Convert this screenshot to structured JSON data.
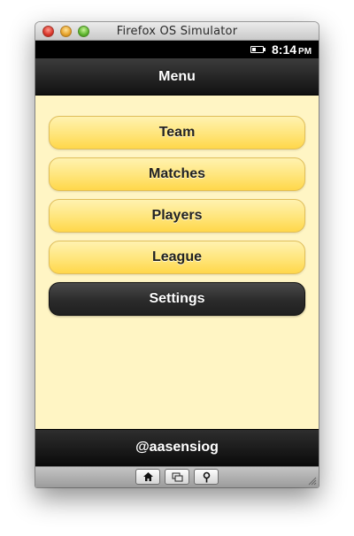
{
  "window": {
    "title": "Firefox OS Simulator"
  },
  "statusbar": {
    "time": "8:14",
    "ampm": "PM",
    "battery_level": 0.35
  },
  "header": {
    "title": "Menu"
  },
  "menu": {
    "items": [
      {
        "label": "Team"
      },
      {
        "label": "Matches"
      },
      {
        "label": "Players"
      },
      {
        "label": "League"
      },
      {
        "label": "Settings"
      }
    ]
  },
  "footer": {
    "text": "@aasensiog"
  },
  "toolbar": {
    "buttons": [
      "home-icon",
      "screens-icon",
      "location-pin-icon"
    ]
  },
  "colors": {
    "content_bg": "#fff5c4",
    "button_yellow": "#ffe57a",
    "button_dark": "#2b2b2b",
    "bar_dark": "#111111"
  }
}
